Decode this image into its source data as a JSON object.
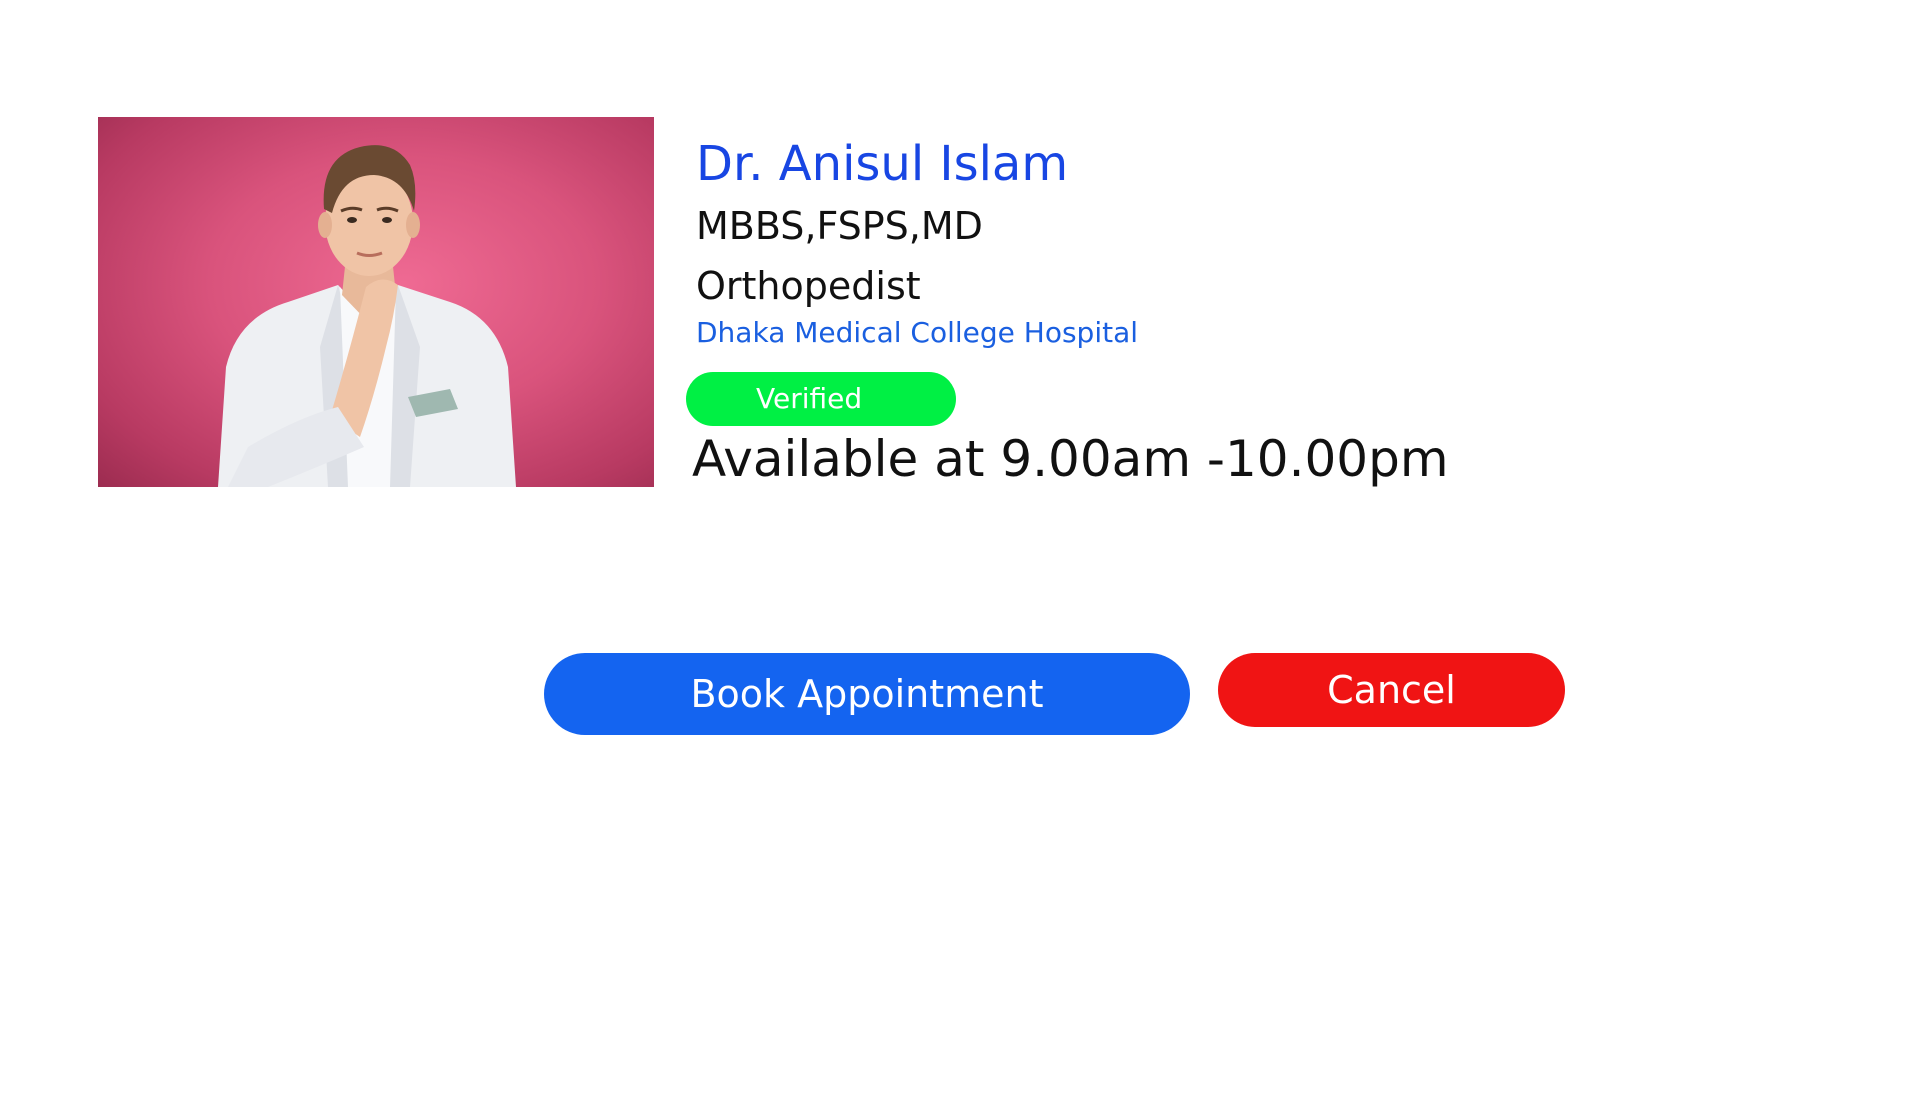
{
  "doctor": {
    "photo_alt": "Doctor portrait",
    "name": "Dr. Anisul Islam",
    "degrees": "MBBS,FSPS,MD",
    "specialty": "Orthopedist",
    "hospital": "Dhaka Medical College Hospital",
    "verified_label": "Verified",
    "availability": "Available at 9.00am -10.00pm"
  },
  "actions": {
    "book_label": "Book Appointment",
    "cancel_label": "Cancel"
  },
  "colors": {
    "name": "#1846e3",
    "hospital": "#1a5fe0",
    "verified": "#00f044",
    "book_button": "#1464f0",
    "cancel_button": "#f01414"
  }
}
